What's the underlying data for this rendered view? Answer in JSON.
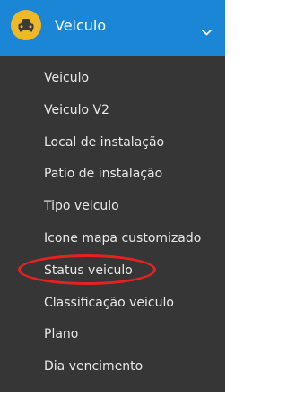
{
  "header": {
    "icon": "car-icon",
    "title": "Veiculo",
    "chevron_icon": "chevron-down-icon"
  },
  "menu": {
    "items": [
      {
        "label": "Veiculo"
      },
      {
        "label": "Veiculo V2"
      },
      {
        "label": "Local de instalação"
      },
      {
        "label": "Patio de instalação"
      },
      {
        "label": "Tipo veiculo"
      },
      {
        "label": "Icone mapa customizado"
      },
      {
        "label": "Status veiculo",
        "highlighted": true
      },
      {
        "label": "Classificação veiculo"
      },
      {
        "label": "Plano"
      },
      {
        "label": "Dia vencimento"
      }
    ]
  },
  "colors": {
    "header_bg": "#1c86d6",
    "menu_bg": "#363636",
    "icon_circle": "#efb829",
    "highlight_ring": "#e52222",
    "text": "#e8e8e8"
  }
}
